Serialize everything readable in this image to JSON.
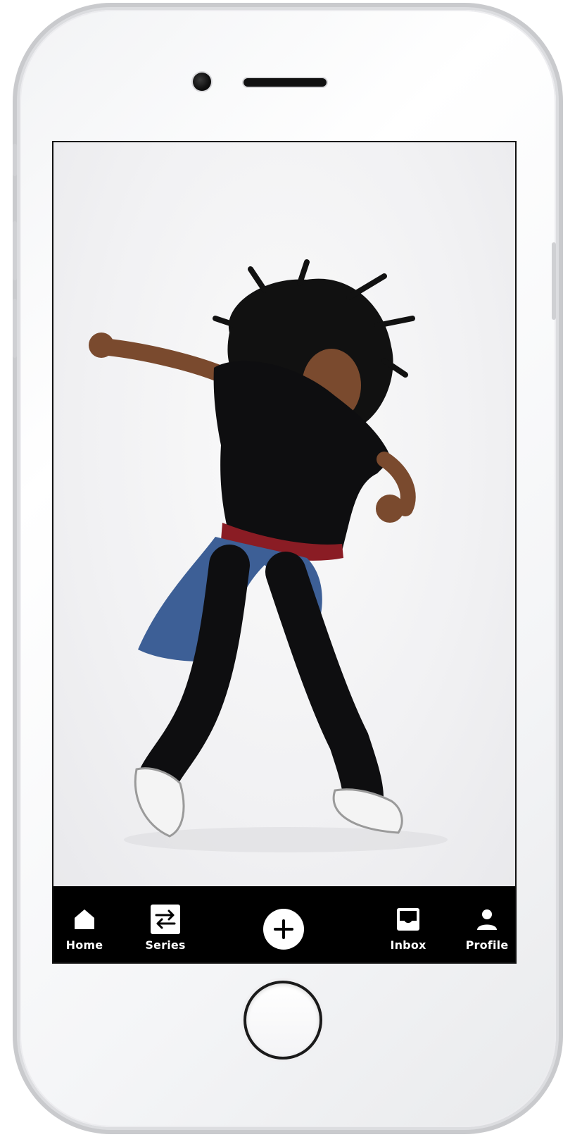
{
  "tabbar": {
    "home_label": "Home",
    "series_label": "Series",
    "add_icon": "plus-circle-icon",
    "inbox_label": "Inbox",
    "profile_label": "Profile"
  },
  "colors": {
    "tabbar_bg": "#000000",
    "tab_text": "#ffffff",
    "photo_bg": "#f2f2f4"
  }
}
